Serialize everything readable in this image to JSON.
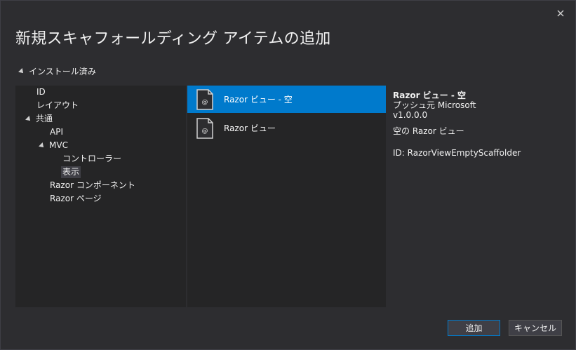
{
  "dialog": {
    "title": "新規スキャフォールディング アイテムの追加",
    "close_label": "×"
  },
  "tree": {
    "installed_label": "インストール済み",
    "items": [
      {
        "label": "ID"
      },
      {
        "label": "レイアウト"
      },
      {
        "label": "共通"
      },
      {
        "label": "API"
      },
      {
        "label": "MVC"
      },
      {
        "label": "コントローラー"
      },
      {
        "label": "表示"
      },
      {
        "label": "Razor コンポーネント"
      },
      {
        "label": "Razor ページ"
      }
    ]
  },
  "templates": [
    {
      "label": "Razor ビュー - 空",
      "icon": "razor-file-icon"
    },
    {
      "label": "Razor ビュー",
      "icon": "razor-file-icon"
    }
  ],
  "details": {
    "name": "Razor ビュー - 空",
    "publisher": "プッシュ元 Microsoft",
    "version": "v1.0.0.0",
    "description": "空の Razor ビュー",
    "id": "ID: RazorViewEmptyScaffolder"
  },
  "buttons": {
    "add": "追加",
    "cancel": "キャンセル"
  },
  "colors": {
    "selection": "#007acc",
    "background": "#2d2d30",
    "panel": "#252526"
  }
}
